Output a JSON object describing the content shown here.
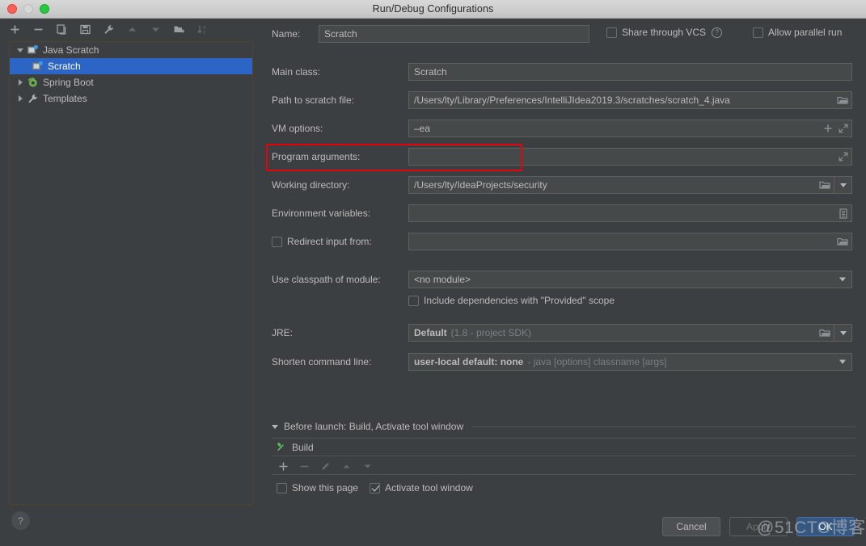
{
  "window": {
    "title": "Run/Debug Configurations",
    "traffic_lights": [
      "close",
      "minimize",
      "zoom"
    ]
  },
  "toolbar": {
    "icons": [
      {
        "name": "add-icon",
        "glyph": "+",
        "enabled": true
      },
      {
        "name": "remove-icon",
        "glyph": "−",
        "enabled": true
      },
      {
        "name": "copy-configuration-icon",
        "glyph": "copy",
        "enabled": true
      },
      {
        "name": "save-configuration-icon",
        "glyph": "save",
        "enabled": true
      },
      {
        "name": "edit-templates-icon",
        "glyph": "wrench",
        "enabled": true
      },
      {
        "name": "move-up-icon",
        "glyph": "triangle-up",
        "enabled": false
      },
      {
        "name": "move-down-icon",
        "glyph": "triangle-down",
        "enabled": false
      },
      {
        "name": "new-folder-icon",
        "glyph": "folder-plus",
        "enabled": true
      },
      {
        "name": "sort-alphabetically-icon",
        "glyph": "sort-az",
        "enabled": false
      }
    ]
  },
  "tree": {
    "items": [
      {
        "label": "Java Scratch",
        "expanded": true,
        "icon": "java-scratch-icon",
        "indent": 0,
        "selected": false,
        "has_twisty": true
      },
      {
        "label": "Scratch",
        "expanded": false,
        "icon": "scratch-config-icon",
        "indent": 1,
        "selected": true,
        "has_twisty": false
      },
      {
        "label": "Spring Boot",
        "expanded": false,
        "icon": "spring-boot-icon",
        "indent": 0,
        "selected": false,
        "has_twisty": true
      },
      {
        "label": "Templates",
        "expanded": false,
        "icon": "wrench-icon",
        "indent": 0,
        "selected": false,
        "has_twisty": true
      }
    ]
  },
  "help_button": {
    "label": "?"
  },
  "form": {
    "name": {
      "label": "Name:",
      "value": "Scratch"
    },
    "share_through_vcs": {
      "label": "Share through VCS",
      "checked": false,
      "help": "?"
    },
    "allow_parallel_run": {
      "label": "Allow parallel run",
      "checked": false
    },
    "main_class": {
      "label": "Main class:",
      "value": "Scratch"
    },
    "path_to_scratch_file": {
      "label": "Path to scratch file:",
      "value": "/Users/lty/Library/Preferences/IntelliJIdea2019.3/scratches/scratch_4.java"
    },
    "vm_options": {
      "label": "VM options:",
      "value": "–ea"
    },
    "program_arguments": {
      "label": "Program arguments:",
      "value": ""
    },
    "working_directory": {
      "label": "Working directory:",
      "value": "/Users/lty/IdeaProjects/security"
    },
    "environment_variables": {
      "label": "Environment variables:",
      "value": ""
    },
    "redirect_input_from": {
      "label": "Redirect input from:",
      "checked": false,
      "value": ""
    },
    "use_classpath_of_module": {
      "label": "Use classpath of module:",
      "value": "<no module>"
    },
    "include_provided_scope": {
      "label": "Include dependencies with \"Provided\" scope",
      "checked": false
    },
    "jre": {
      "label": "JRE:",
      "value": "Default",
      "hint": "(1.8 - project SDK)"
    },
    "shorten_command_line": {
      "label": "Shorten command line:",
      "value": "user-local default: none",
      "hint": "- java [options] classname [args]"
    }
  },
  "before_launch": {
    "header": "Before launch: Build, Activate tool window",
    "tasks": [
      {
        "label": "Build",
        "icon": "build-hammer-icon"
      }
    ],
    "toolbar": [
      {
        "name": "add-task-icon",
        "glyph": "+",
        "enabled": true
      },
      {
        "name": "remove-task-icon",
        "glyph": "−",
        "enabled": false
      },
      {
        "name": "edit-task-icon",
        "glyph": "pencil",
        "enabled": false
      },
      {
        "name": "move-task-up-icon",
        "glyph": "triangle-up",
        "enabled": false
      },
      {
        "name": "move-task-down-icon",
        "glyph": "triangle-down",
        "enabled": false
      }
    ],
    "show_this_page": {
      "label": "Show this page",
      "checked": false
    },
    "activate_tool_window": {
      "label": "Activate tool window",
      "checked": true
    }
  },
  "buttons": {
    "cancel": "Cancel",
    "apply": "Apply",
    "ok": "OK"
  },
  "annotation": {
    "highlight_target": "vm-options-row",
    "color": "#e8000b"
  },
  "watermark": {
    "text": "@51CTO博客"
  }
}
